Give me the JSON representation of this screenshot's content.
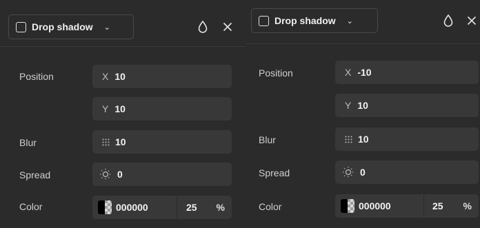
{
  "panels": [
    {
      "header": {
        "effect_label": "Drop shadow"
      },
      "labels": {
        "position": "Position",
        "blur": "Blur",
        "spread": "Spread",
        "color": "Color"
      },
      "position": {
        "x_axis": "X",
        "x": "10",
        "y_axis": "Y",
        "y": "10"
      },
      "blur": "10",
      "spread": "0",
      "color": {
        "hex": "000000",
        "opacity": "25",
        "unit": "%"
      }
    },
    {
      "header": {
        "effect_label": "Drop shadow"
      },
      "labels": {
        "position": "Position",
        "blur": "Blur",
        "spread": "Spread",
        "color": "Color"
      },
      "position": {
        "x_axis": "X",
        "x": "-10",
        "y_axis": "Y",
        "y": "10"
      },
      "blur": "10",
      "spread": "0",
      "color": {
        "hex": "000000",
        "opacity": "25",
        "unit": "%"
      }
    }
  ],
  "icons": {
    "dropdown": "chevron-down-icon",
    "visibility": "droplet-icon",
    "remove": "close-icon",
    "blur": "blur-grid-icon",
    "spread": "spread-sun-icon"
  },
  "colors": {
    "panel_bg": "#2b2b2b",
    "field_bg": "#383838",
    "text": "#f2f2f2",
    "label": "#cfcfcf"
  }
}
